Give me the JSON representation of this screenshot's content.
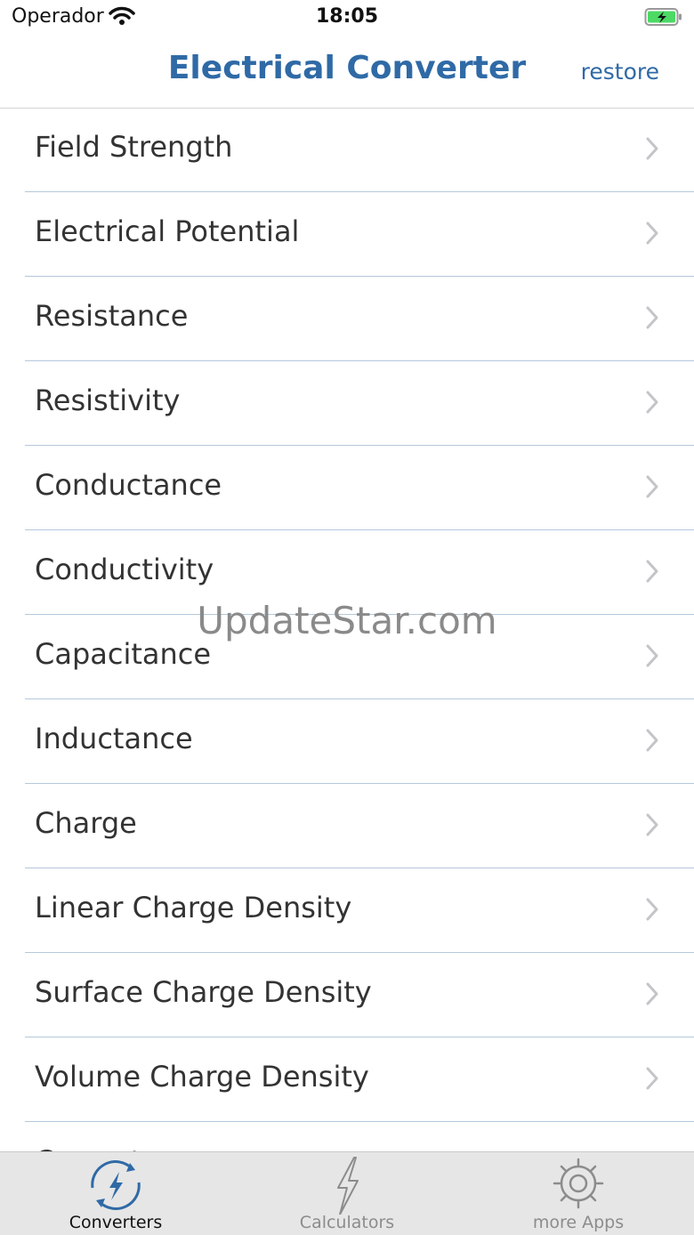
{
  "status": {
    "carrier": "Operador",
    "time": "18:05"
  },
  "nav": {
    "title": "Electrical Converter",
    "restore": "restore"
  },
  "rows": [
    {
      "label": "Field Strength"
    },
    {
      "label": "Electrical Potential"
    },
    {
      "label": "Resistance"
    },
    {
      "label": "Resistivity"
    },
    {
      "label": "Conductance"
    },
    {
      "label": "Conductivity"
    },
    {
      "label": "Capacitance"
    },
    {
      "label": "Inductance"
    },
    {
      "label": "Charge"
    },
    {
      "label": "Linear Charge Density"
    },
    {
      "label": "Surface Charge Density"
    },
    {
      "label": "Volume Charge Density"
    },
    {
      "label": "Current"
    }
  ],
  "watermark": "UpdateStar.com",
  "tabs": [
    {
      "label": "Converters",
      "icon": "converters-icon",
      "active": true
    },
    {
      "label": "Calculators",
      "icon": "lightning-icon",
      "active": false
    },
    {
      "label": "more Apps",
      "icon": "gear-icon",
      "active": false
    }
  ],
  "colors": {
    "accent": "#2f6aa6",
    "separator": "#b5c8dc",
    "tabbar": "#e6e6e6",
    "battery": "#4cd964"
  }
}
